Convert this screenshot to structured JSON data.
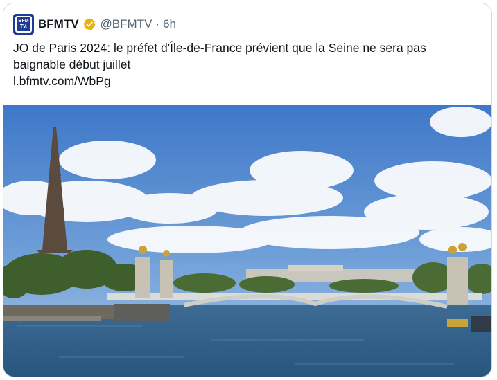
{
  "tweet": {
    "author_name": "BFMTV",
    "handle": "@BFMTV",
    "separator": "·",
    "time": "6h",
    "avatar_text_line1": "BFM",
    "avatar_text_line2": "TV.",
    "text": "JO de Paris 2024: le préfet d'Île-de-France prévient que la Seine ne sera pas baignable début juillet",
    "link": "l.bfmtv.com/WbPg"
  },
  "colors": {
    "verified_badge": "#e8b20a",
    "avatar_bg": "#1f3b93",
    "secondary_text": "#536471",
    "border": "#cfd9de"
  }
}
